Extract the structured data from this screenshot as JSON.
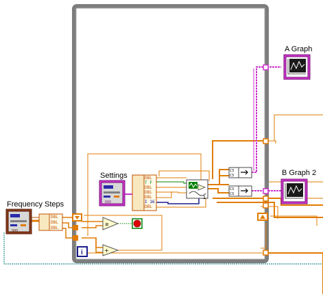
{
  "labels": {
    "frequency_steps": "Frequency Steps",
    "settings": "Settings",
    "a_graph": "A Graph",
    "b_graph_2": "B Graph 2",
    "loop_index": "i"
  },
  "unbundle_terms": {
    "frequency": [
      "DBL",
      "DBL",
      "DBL"
    ],
    "settings": [
      "DBL",
      "T F",
      "DBL",
      "DBL",
      "DBL",
      "I 16",
      "DBL"
    ]
  },
  "constants": {
    "node_index": "1",
    "cluster_tag": "C3"
  },
  "colors": {
    "loop_border": "#7d7d7d",
    "orange_wire": "#e07b00",
    "pink_wire": "#cc33cc",
    "blue_wire": "#1a1a8c",
    "teal_wire": "#007a7a",
    "green_wire": "#008000",
    "stop_red": "#e00000"
  },
  "icons": {
    "frequency_steps": "cluster-control-icon",
    "settings": "cluster-control-icon",
    "a_graph": "waveform-graph-icon",
    "b_graph_2": "waveform-graph-icon",
    "compare": "greater-or-equal-icon",
    "add": "add-icon",
    "stop": "stop-condition-icon",
    "shift_register": "shift-register-icon"
  }
}
